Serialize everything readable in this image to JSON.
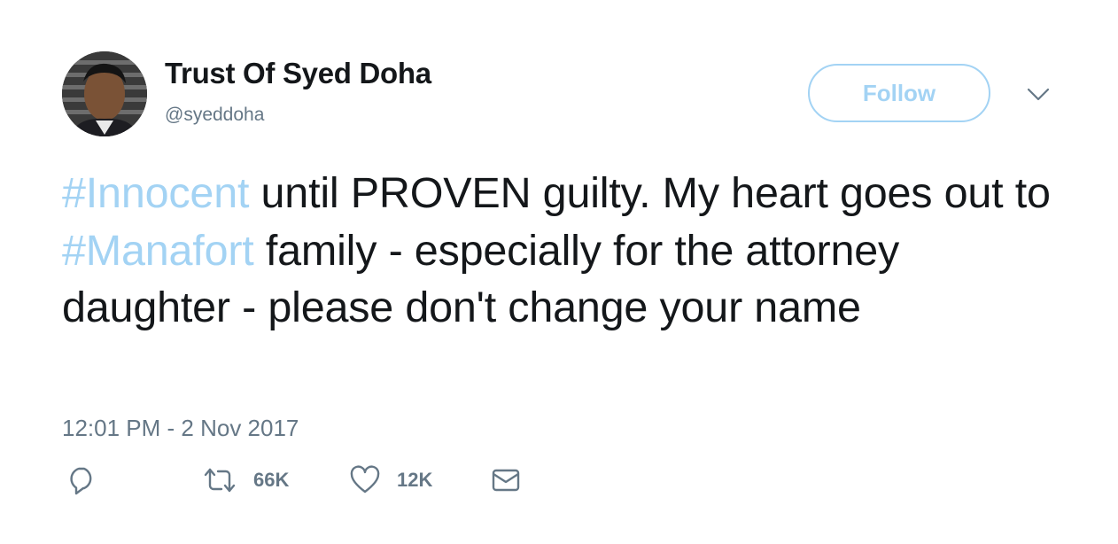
{
  "user": {
    "display_name": "Trust Of Syed Doha",
    "handle": "@syeddoha",
    "avatar_icon": "profile-photo"
  },
  "follow": {
    "label": "Follow",
    "color": "#a3d3f4"
  },
  "menu": {
    "icon": "chevron-down-icon"
  },
  "tweet": {
    "segments": [
      {
        "text": "#Innocent",
        "type": "hashtag"
      },
      {
        "text": " until PROVEN guilty. My heart goes out to ",
        "type": "text"
      },
      {
        "text": "#Manafort",
        "type": "hashtag"
      },
      {
        "text": " family - especially for the attorney daughter - please don't change your name",
        "type": "text"
      }
    ]
  },
  "timestamp": "12:01 PM - 2 Nov 2017",
  "actions": {
    "reply": {
      "icon": "reply-icon"
    },
    "retweet": {
      "icon": "retweet-icon",
      "count": "66K"
    },
    "like": {
      "icon": "heart-icon",
      "count": "12K"
    },
    "message": {
      "icon": "envelope-icon"
    }
  },
  "colors": {
    "link": "#a3d3f4",
    "text": "#14171a",
    "secondary": "#657786"
  }
}
